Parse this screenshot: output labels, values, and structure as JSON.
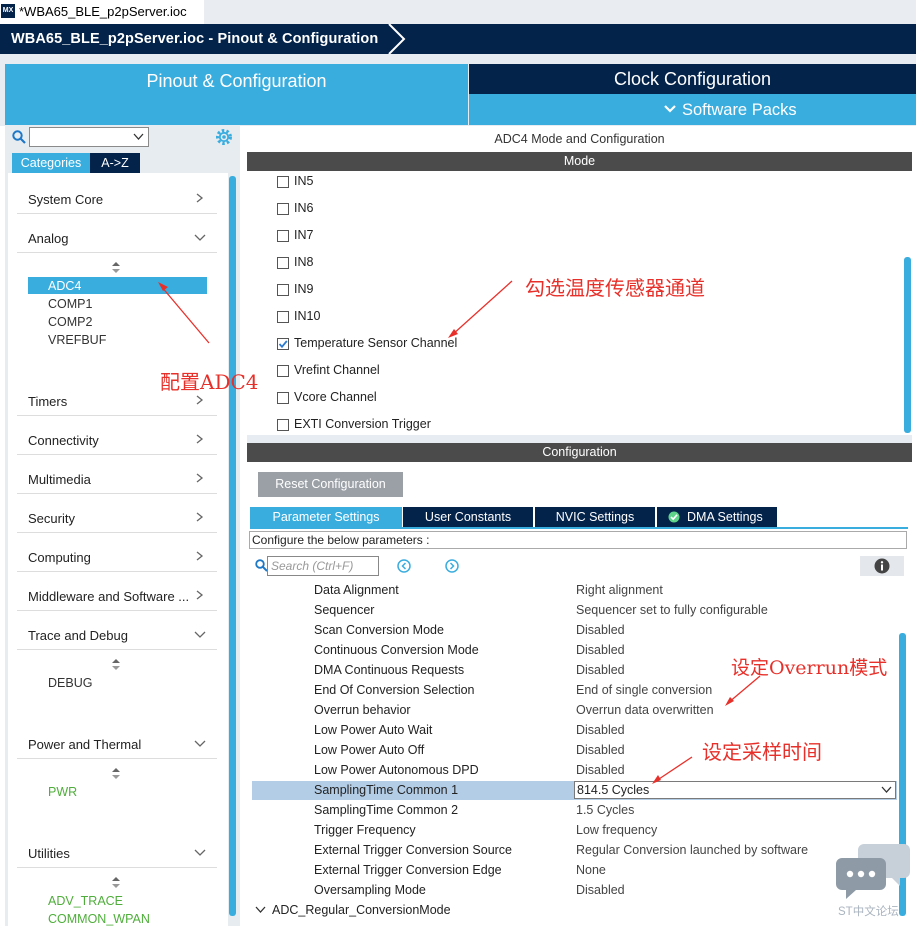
{
  "window": {
    "file_tab": "*WBA65_BLE_p2pServer.ioc",
    "app_badge": "MX",
    "breadcrumb": "WBA65_BLE_p2pServer.ioc - Pinout & Configuration"
  },
  "main_tabs": {
    "pinout": "Pinout & Configuration",
    "clock": "Clock Configuration",
    "software_packs": "Software Packs"
  },
  "sidebar": {
    "btn_categories": "Categories",
    "btn_az": "A->Z",
    "categories": [
      {
        "label": "System Core"
      },
      {
        "label": "Analog"
      },
      {
        "label": "Timers"
      },
      {
        "label": "Connectivity"
      },
      {
        "label": "Multimedia"
      },
      {
        "label": "Security"
      },
      {
        "label": "Computing"
      },
      {
        "label": "Middleware and Software ..."
      },
      {
        "label": "Trace and Debug"
      },
      {
        "label": "Power and Thermal"
      },
      {
        "label": "Utilities"
      }
    ],
    "analog_items": [
      "ADC4",
      "COMP1",
      "COMP2",
      "VREFBUF"
    ],
    "debug_items": [
      "DEBUG"
    ],
    "power_items": [
      "PWR"
    ],
    "utility_items": [
      "ADV_TRACE",
      "COMMON_WPAN"
    ]
  },
  "mode_panel": {
    "title": "ADC4 Mode and Configuration",
    "mode_header": "Mode",
    "items": [
      {
        "label": "IN5",
        "checked": false
      },
      {
        "label": "IN6",
        "checked": false
      },
      {
        "label": "IN7",
        "checked": false
      },
      {
        "label": "IN8",
        "checked": false
      },
      {
        "label": "IN9",
        "checked": false
      },
      {
        "label": "IN10",
        "checked": false
      },
      {
        "label": "Temperature Sensor Channel",
        "checked": true
      },
      {
        "label": "Vrefint Channel",
        "checked": false
      },
      {
        "label": "Vcore Channel",
        "checked": false
      },
      {
        "label": "EXTI Conversion Trigger",
        "checked": false
      }
    ]
  },
  "config_panel": {
    "header": "Configuration",
    "reset_button": "Reset Configuration",
    "tabs": [
      "Parameter Settings",
      "User Constants",
      "NVIC Settings",
      "DMA Settings"
    ],
    "note": "Configure the below parameters :",
    "search_placeholder": "Search (Ctrl+F)",
    "params": [
      {
        "name": "Data Alignment",
        "value": "Right alignment"
      },
      {
        "name": "Sequencer",
        "value": "Sequencer set to fully configurable"
      },
      {
        "name": "Scan Conversion Mode",
        "value": "Disabled"
      },
      {
        "name": "Continuous Conversion Mode",
        "value": "Disabled"
      },
      {
        "name": "DMA Continuous Requests",
        "value": "Disabled"
      },
      {
        "name": "End Of Conversion Selection",
        "value": "End of single conversion"
      },
      {
        "name": "Overrun behavior",
        "value": "Overrun data overwritten"
      },
      {
        "name": "Low Power Auto Wait",
        "value": "Disabled"
      },
      {
        "name": "Low Power Auto Off",
        "value": "Disabled"
      },
      {
        "name": "Low Power Autonomous DPD",
        "value": "Disabled"
      },
      {
        "name": "SamplingTime Common 1",
        "value": "814.5 Cycles"
      },
      {
        "name": "SamplingTime Common 2",
        "value": "1.5 Cycles"
      },
      {
        "name": "Trigger Frequency",
        "value": "Low frequency"
      },
      {
        "name": "External Trigger Conversion Source",
        "value": "Regular Conversion launched by software"
      },
      {
        "name": "External Trigger Conversion Edge",
        "value": "None"
      },
      {
        "name": "Oversampling Mode",
        "value": "Disabled"
      }
    ],
    "group_row": "ADC_Regular_ConversionMode"
  },
  "annotations": {
    "adc4": "配置ADC4",
    "temp": "勾选温度传感器通道",
    "overrun": "设定Overrun模式",
    "sampling": "设定采样时间"
  },
  "watermark": "ST中文论坛",
  "colors": {
    "accent": "#3aaddf",
    "navy": "#03234b",
    "annotation": "#e8302a"
  }
}
